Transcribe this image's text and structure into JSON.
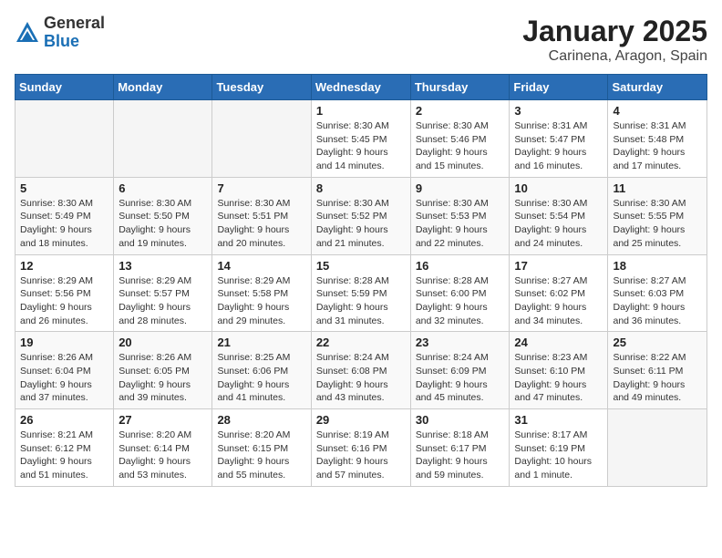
{
  "header": {
    "logo_general": "General",
    "logo_blue": "Blue",
    "month": "January 2025",
    "location": "Carinena, Aragon, Spain"
  },
  "weekdays": [
    "Sunday",
    "Monday",
    "Tuesday",
    "Wednesday",
    "Thursday",
    "Friday",
    "Saturday"
  ],
  "weeks": [
    [
      {
        "day": "",
        "info": ""
      },
      {
        "day": "",
        "info": ""
      },
      {
        "day": "",
        "info": ""
      },
      {
        "day": "1",
        "info": "Sunrise: 8:30 AM\nSunset: 5:45 PM\nDaylight: 9 hours\nand 14 minutes."
      },
      {
        "day": "2",
        "info": "Sunrise: 8:30 AM\nSunset: 5:46 PM\nDaylight: 9 hours\nand 15 minutes."
      },
      {
        "day": "3",
        "info": "Sunrise: 8:31 AM\nSunset: 5:47 PM\nDaylight: 9 hours\nand 16 minutes."
      },
      {
        "day": "4",
        "info": "Sunrise: 8:31 AM\nSunset: 5:48 PM\nDaylight: 9 hours\nand 17 minutes."
      }
    ],
    [
      {
        "day": "5",
        "info": "Sunrise: 8:30 AM\nSunset: 5:49 PM\nDaylight: 9 hours\nand 18 minutes."
      },
      {
        "day": "6",
        "info": "Sunrise: 8:30 AM\nSunset: 5:50 PM\nDaylight: 9 hours\nand 19 minutes."
      },
      {
        "day": "7",
        "info": "Sunrise: 8:30 AM\nSunset: 5:51 PM\nDaylight: 9 hours\nand 20 minutes."
      },
      {
        "day": "8",
        "info": "Sunrise: 8:30 AM\nSunset: 5:52 PM\nDaylight: 9 hours\nand 21 minutes."
      },
      {
        "day": "9",
        "info": "Sunrise: 8:30 AM\nSunset: 5:53 PM\nDaylight: 9 hours\nand 22 minutes."
      },
      {
        "day": "10",
        "info": "Sunrise: 8:30 AM\nSunset: 5:54 PM\nDaylight: 9 hours\nand 24 minutes."
      },
      {
        "day": "11",
        "info": "Sunrise: 8:30 AM\nSunset: 5:55 PM\nDaylight: 9 hours\nand 25 minutes."
      }
    ],
    [
      {
        "day": "12",
        "info": "Sunrise: 8:29 AM\nSunset: 5:56 PM\nDaylight: 9 hours\nand 26 minutes."
      },
      {
        "day": "13",
        "info": "Sunrise: 8:29 AM\nSunset: 5:57 PM\nDaylight: 9 hours\nand 28 minutes."
      },
      {
        "day": "14",
        "info": "Sunrise: 8:29 AM\nSunset: 5:58 PM\nDaylight: 9 hours\nand 29 minutes."
      },
      {
        "day": "15",
        "info": "Sunrise: 8:28 AM\nSunset: 5:59 PM\nDaylight: 9 hours\nand 31 minutes."
      },
      {
        "day": "16",
        "info": "Sunrise: 8:28 AM\nSunset: 6:00 PM\nDaylight: 9 hours\nand 32 minutes."
      },
      {
        "day": "17",
        "info": "Sunrise: 8:27 AM\nSunset: 6:02 PM\nDaylight: 9 hours\nand 34 minutes."
      },
      {
        "day": "18",
        "info": "Sunrise: 8:27 AM\nSunset: 6:03 PM\nDaylight: 9 hours\nand 36 minutes."
      }
    ],
    [
      {
        "day": "19",
        "info": "Sunrise: 8:26 AM\nSunset: 6:04 PM\nDaylight: 9 hours\nand 37 minutes."
      },
      {
        "day": "20",
        "info": "Sunrise: 8:26 AM\nSunset: 6:05 PM\nDaylight: 9 hours\nand 39 minutes."
      },
      {
        "day": "21",
        "info": "Sunrise: 8:25 AM\nSunset: 6:06 PM\nDaylight: 9 hours\nand 41 minutes."
      },
      {
        "day": "22",
        "info": "Sunrise: 8:24 AM\nSunset: 6:08 PM\nDaylight: 9 hours\nand 43 minutes."
      },
      {
        "day": "23",
        "info": "Sunrise: 8:24 AM\nSunset: 6:09 PM\nDaylight: 9 hours\nand 45 minutes."
      },
      {
        "day": "24",
        "info": "Sunrise: 8:23 AM\nSunset: 6:10 PM\nDaylight: 9 hours\nand 47 minutes."
      },
      {
        "day": "25",
        "info": "Sunrise: 8:22 AM\nSunset: 6:11 PM\nDaylight: 9 hours\nand 49 minutes."
      }
    ],
    [
      {
        "day": "26",
        "info": "Sunrise: 8:21 AM\nSunset: 6:12 PM\nDaylight: 9 hours\nand 51 minutes."
      },
      {
        "day": "27",
        "info": "Sunrise: 8:20 AM\nSunset: 6:14 PM\nDaylight: 9 hours\nand 53 minutes."
      },
      {
        "day": "28",
        "info": "Sunrise: 8:20 AM\nSunset: 6:15 PM\nDaylight: 9 hours\nand 55 minutes."
      },
      {
        "day": "29",
        "info": "Sunrise: 8:19 AM\nSunset: 6:16 PM\nDaylight: 9 hours\nand 57 minutes."
      },
      {
        "day": "30",
        "info": "Sunrise: 8:18 AM\nSunset: 6:17 PM\nDaylight: 9 hours\nand 59 minutes."
      },
      {
        "day": "31",
        "info": "Sunrise: 8:17 AM\nSunset: 6:19 PM\nDaylight: 10 hours\nand 1 minute."
      },
      {
        "day": "",
        "info": ""
      }
    ]
  ]
}
